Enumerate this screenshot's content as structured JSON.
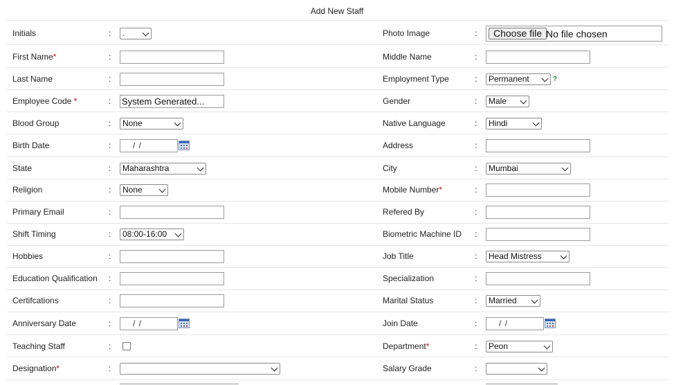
{
  "page_title": "Add New Staff",
  "colon": ":",
  "required_mark": "*",
  "help_mark": "?",
  "fields": {
    "initials": {
      "label": "Initials",
      "value": "."
    },
    "photo_image": {
      "label": "Photo Image",
      "button": "Choose file",
      "status": "No file chosen"
    },
    "first_name": {
      "label": "First Name",
      "value": ""
    },
    "middle_name": {
      "label": "Middle Name",
      "value": ""
    },
    "last_name": {
      "label": "Last Name",
      "value": ""
    },
    "employment_type": {
      "label": "Employment Type",
      "value": "Permanent"
    },
    "employee_code": {
      "label": "Employee Code ",
      "value": "System Generated..."
    },
    "gender": {
      "label": "Gender",
      "value": "Male"
    },
    "blood_group": {
      "label": "Blood Group",
      "value": "None"
    },
    "native_language": {
      "label": "Native Language",
      "value": "Hindi"
    },
    "birth_date": {
      "label": "Birth Date",
      "value": "/ /"
    },
    "address": {
      "label": "Address",
      "value": ""
    },
    "state": {
      "label": "State",
      "value": "Maharashtra"
    },
    "city": {
      "label": "City",
      "value": "Mumbai"
    },
    "religion": {
      "label": "Religion",
      "value": "None"
    },
    "mobile_number": {
      "label": "Mobile Number",
      "value": ""
    },
    "primary_email": {
      "label": "Primary Email",
      "value": ""
    },
    "refered_by": {
      "label": "Refered By",
      "value": ""
    },
    "shift_timing": {
      "label": "Shift Timing",
      "value": "08:00-16:00"
    },
    "biometric_machine_id": {
      "label": "Biometric Machine ID",
      "value": ""
    },
    "hobbies": {
      "label": "Hobbies",
      "value": ""
    },
    "job_title": {
      "label": "Job Title",
      "value": "Head Mistress"
    },
    "education_qualification": {
      "label": "Education Qualification",
      "value": ""
    },
    "specialization": {
      "label": "Specialization",
      "value": ""
    },
    "certifications": {
      "label": "Certifcations",
      "value": ""
    },
    "marital_status": {
      "label": "Marital Status",
      "value": "Married"
    },
    "anniversary_date": {
      "label": "Anniversary Date",
      "value": "/ /"
    },
    "join_date": {
      "label": "Join Date",
      "value": "/ /"
    },
    "teaching_staff": {
      "label": "Teaching Staff",
      "checked": false
    },
    "department": {
      "label": "Department",
      "value": "Peon"
    },
    "designation": {
      "label": "Designation",
      "value": ""
    },
    "salary_grade": {
      "label": "Salary Grade",
      "value": ""
    }
  },
  "colors": {
    "required": "#d0021b",
    "help": "#0a8a2a",
    "border": "#9a9a9a"
  }
}
